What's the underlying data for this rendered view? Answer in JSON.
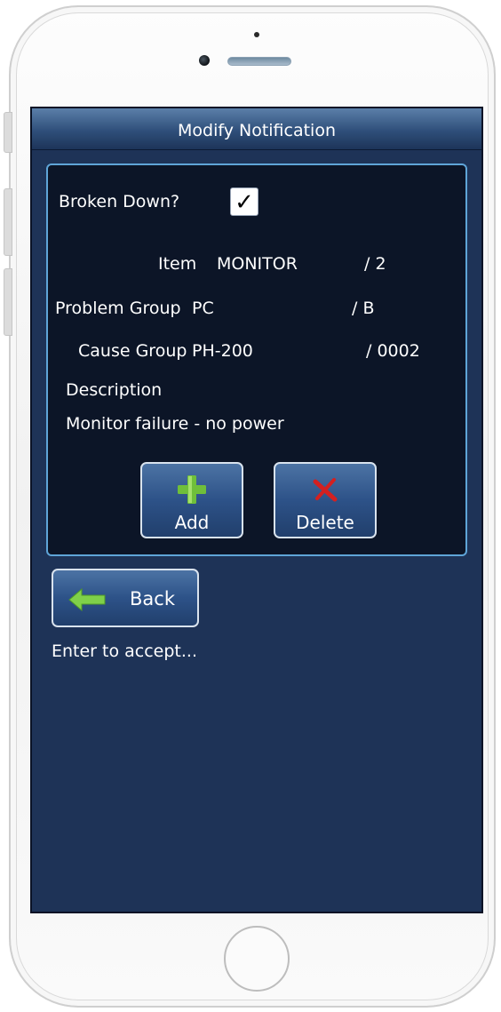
{
  "screen": {
    "title": "Modify Notification",
    "broken_down": {
      "label": "Broken Down?",
      "checked": true,
      "mark": "✓"
    },
    "item": {
      "label": "Item",
      "value": "MONITOR",
      "code": "/ 2"
    },
    "problem_group": {
      "label": "Problem Group",
      "value": "PC",
      "code": "/ B"
    },
    "cause_group": {
      "label": "Cause Group",
      "value": "PH-200",
      "code": "/ 0002"
    },
    "description": {
      "label": "Description",
      "value": "Monitor failure - no power"
    },
    "buttons": {
      "add": {
        "label": "Add",
        "icon": "plus-icon"
      },
      "delete": {
        "label": "Delete",
        "icon": "x-icon"
      },
      "back": {
        "label": "Back",
        "icon": "left-arrow-icon"
      }
    },
    "status": "Enter to accept..."
  },
  "colors": {
    "screen_bg": "#1e3357",
    "panel_bg": "#0c1527",
    "panel_border": "#5fa5d8",
    "button_bg": "#2d5288",
    "add_icon": "#6fbf3a",
    "delete_icon": "#d42020",
    "back_icon": "#7fd04a"
  }
}
